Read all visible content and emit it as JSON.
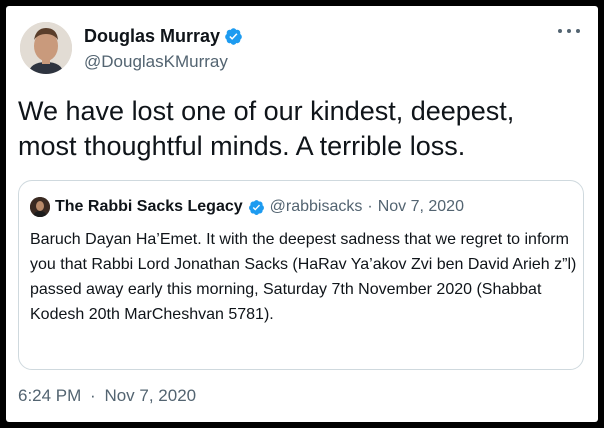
{
  "author": {
    "name": "Douglas Murray",
    "handle": "@DouglasKMurray"
  },
  "tweet": {
    "text": "We have lost one of our kindest, deepest, most thoughtful minds. A terrible loss."
  },
  "quoted": {
    "name": "The Rabbi Sacks Legacy",
    "handle": "@rabbisacks",
    "separator": "·",
    "date": "Nov 7, 2020",
    "text": "Baruch Dayan Ha’Emet. It with the deepest sadness that we regret to inform you that Rabbi Lord Jonathan Sacks (HaRav Ya’akov Zvi ben David Arieh z”l) passed away early this morning, Saturday 7th November 2020 (Shabbat Kodesh 20th MarCheshvan 5781)."
  },
  "footer": {
    "time": "6:24 PM",
    "separator": "·",
    "date": "Nov 7, 2020"
  },
  "icons": {
    "verified": "verified-badge-icon",
    "more": "more-options-icon"
  },
  "colors": {
    "verified": "#1d9bf0",
    "text": "#0f1419",
    "secondary": "#536471",
    "border": "#cfd9de"
  }
}
